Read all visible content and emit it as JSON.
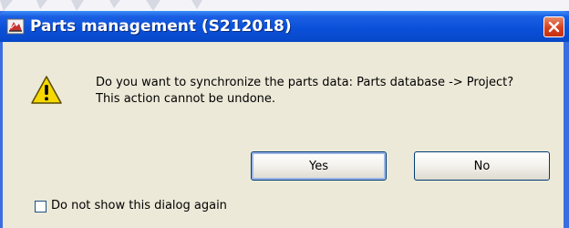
{
  "window": {
    "title": "Parts management (S212018)",
    "icons": {
      "app": "parts-app-icon",
      "close": "close-icon",
      "warning": "warning-icon"
    }
  },
  "message": {
    "line1": "Do you want to synchronize the parts data: Parts database -> Project?",
    "line2": "This action cannot be undone."
  },
  "buttons": {
    "yes": "Yes",
    "no": "No"
  },
  "checkbox": {
    "label": "Do not show this dialog again",
    "checked": false
  },
  "colors": {
    "titlebar": "#0a4fd8",
    "dialog_bg": "#ece9d8",
    "close": "#d8401c",
    "warning": "#f5d800"
  }
}
